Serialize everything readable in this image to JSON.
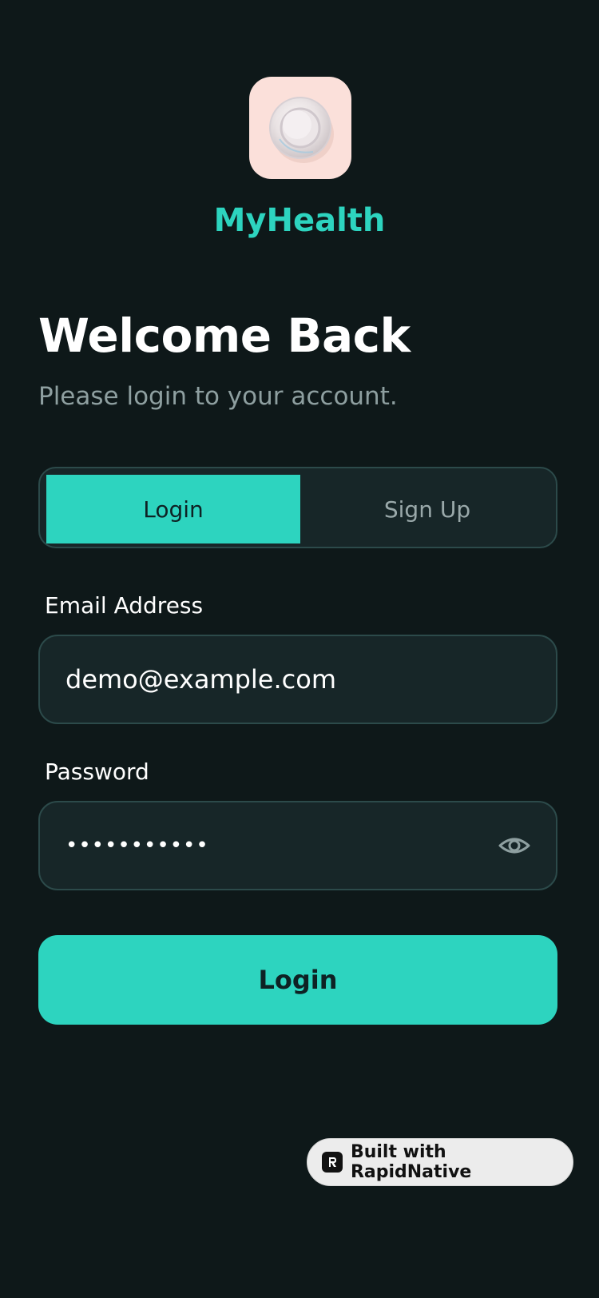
{
  "app": {
    "name": "MyHealth",
    "logo_icon": "glass-ring-icon",
    "accent_color": "#2dd4bf"
  },
  "header": {
    "title": "Welcome Back",
    "subtitle": "Please login to your account."
  },
  "tabs": [
    {
      "label": "Login",
      "selected": true
    },
    {
      "label": "Sign Up",
      "selected": false
    }
  ],
  "form": {
    "email": {
      "label": "Email Address",
      "value": "demo@example.com"
    },
    "password": {
      "label": "Password",
      "masked_value": "•••••••••••",
      "toggle_icon": "eye-icon"
    },
    "submit_label": "Login"
  },
  "badge": {
    "label": "Built with RapidNative",
    "icon": "rapidnative-logo-icon"
  }
}
